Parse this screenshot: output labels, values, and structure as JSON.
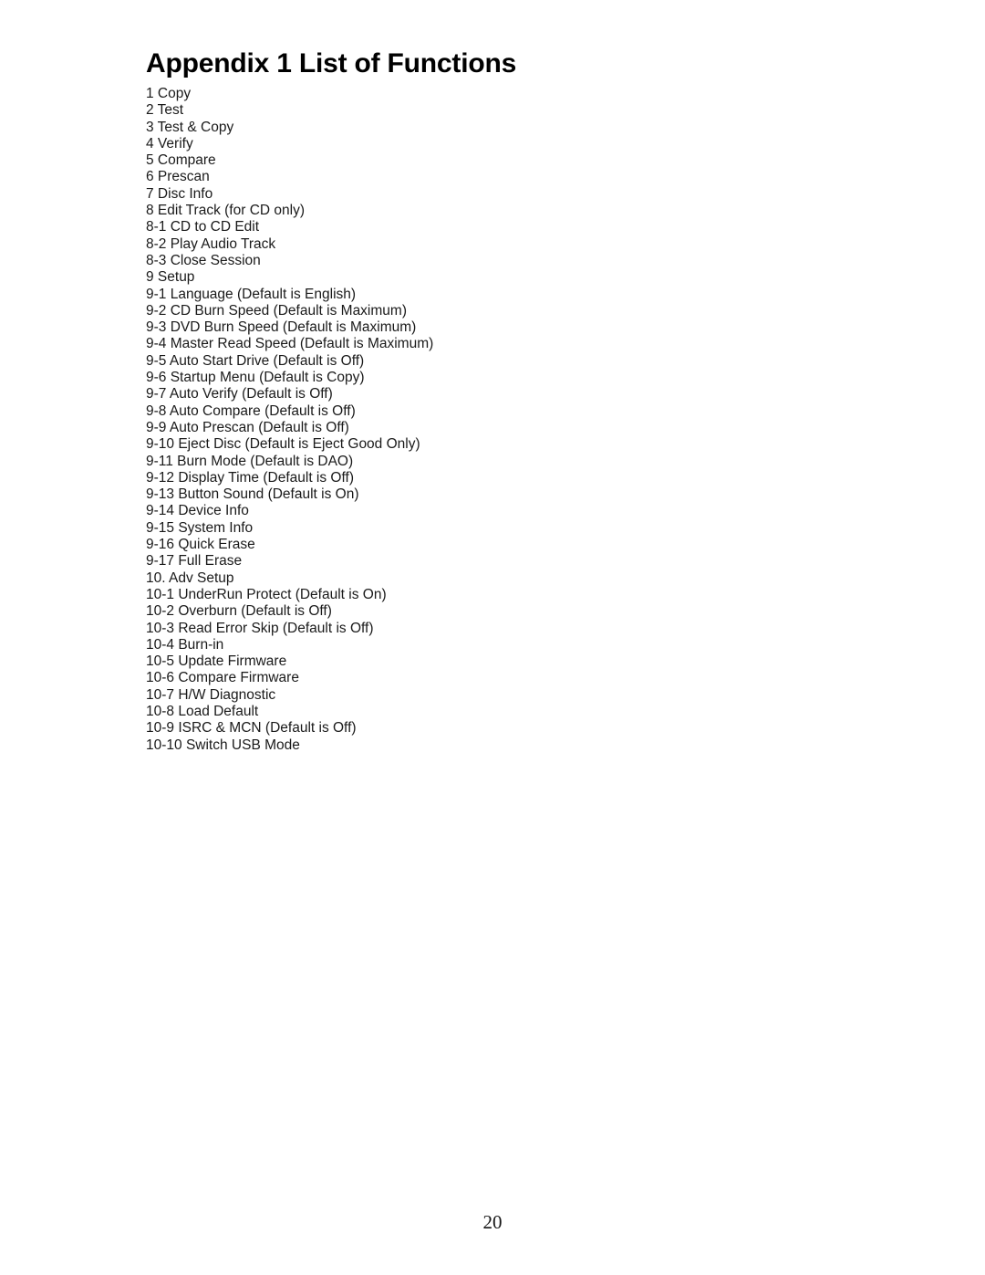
{
  "document": {
    "title": "Appendix 1 List of Functions",
    "page_number": "20",
    "items": [
      {
        "level": 0,
        "text": "1 Copy"
      },
      {
        "level": 0,
        "text": "2 Test"
      },
      {
        "level": 0,
        "text": "3 Test & Copy"
      },
      {
        "level": 0,
        "text": "4 Verify"
      },
      {
        "level": 0,
        "text": "5 Compare"
      },
      {
        "level": 0,
        "text": "6 Prescan"
      },
      {
        "level": 0,
        "text": "7 Disc Info"
      },
      {
        "level": 0,
        "text": "8 Edit Track (for CD only)"
      },
      {
        "level": 1,
        "text": "8-1 CD to CD Edit"
      },
      {
        "level": 1,
        "text": "8-2 Play Audio Track"
      },
      {
        "level": 1,
        "text": "8-3 Close Session"
      },
      {
        "level": 0,
        "text": "9 Setup"
      },
      {
        "level": 1,
        "text": "9-1 Language (Default is English)"
      },
      {
        "level": 1,
        "text": "9-2 CD Burn Speed (Default is Maximum)"
      },
      {
        "level": 1,
        "text": "9-3 DVD Burn Speed (Default is Maximum)"
      },
      {
        "level": 1,
        "text": "9-4 Master Read Speed (Default is Maximum)"
      },
      {
        "level": 1,
        "text": "9-5 Auto Start Drive (Default is Off)"
      },
      {
        "level": 1,
        "text": "9-6 Startup Menu (Default is Copy)"
      },
      {
        "level": 1,
        "text": "9-7 Auto Verify (Default is Off)"
      },
      {
        "level": 1,
        "text": "9-8 Auto Compare (Default is Off)"
      },
      {
        "level": 1,
        "text": "9-9 Auto Prescan (Default is Off)"
      },
      {
        "level": 1,
        "text": "9-10 Eject Disc (Default is Eject Good Only)"
      },
      {
        "level": 1,
        "text": "9-11 Burn Mode (Default is DAO)"
      },
      {
        "level": 1,
        "text": "9-12 Display Time (Default is Off)"
      },
      {
        "level": 1,
        "text": "9-13 Button Sound (Default is On)"
      },
      {
        "level": 1,
        "text": "9-14 Device Info"
      },
      {
        "level": 1,
        "text": "9-15 System Info"
      },
      {
        "level": 1,
        "text": "9-16 Quick Erase"
      },
      {
        "level": 1,
        "text": "9-17 Full Erase"
      },
      {
        "level": 0,
        "text": "10. Adv Setup"
      },
      {
        "level": 1,
        "text": "10-1 UnderRun Protect (Default is On)"
      },
      {
        "level": 1,
        "text": "10-2 Overburn (Default is Off)"
      },
      {
        "level": 1,
        "text": "10-3 Read Error Skip (Default is Off)"
      },
      {
        "level": 1,
        "text": "10-4 Burn-in"
      },
      {
        "level": 1,
        "text": "10-5 Update Firmware"
      },
      {
        "level": 1,
        "text": "10-6 Compare Firmware"
      },
      {
        "level": 1,
        "text": "10-7 H/W Diagnostic"
      },
      {
        "level": 1,
        "text": "10-8 Load Default"
      },
      {
        "level": 1,
        "text": "10-9 ISRC & MCN (Default is Off)"
      },
      {
        "level": 1,
        "text": "10-10 Switch USB Mode"
      }
    ]
  }
}
